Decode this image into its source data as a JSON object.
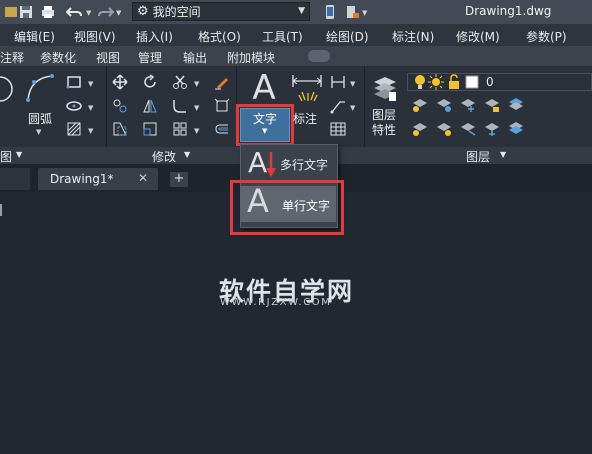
{
  "window": {
    "workspace": "我的空间",
    "document_title": "Drawing1.dwg"
  },
  "menu": {
    "items": [
      "编辑(E)",
      "视图(V)",
      "插入(I)",
      "格式(O)",
      "工具(T)",
      "绘图(D)",
      "标注(N)",
      "修改(M)",
      "参数(P)"
    ]
  },
  "ribbon_tabs": {
    "items": [
      "注释",
      "参数化",
      "视图",
      "管理",
      "输出",
      "附加模块"
    ]
  },
  "draw_panel": {
    "arc_label": "圆弧",
    "footer_label": "图"
  },
  "modify_panel": {
    "footer_label": "修改"
  },
  "annotation_panel": {
    "text_button_label": "文字",
    "dimension_label": "标注"
  },
  "layers_panel": {
    "layer_props_label_line1": "图层",
    "layer_props_label_line2": "特性",
    "current_layer": "0",
    "footer_label": "图层"
  },
  "text_dropdown": {
    "multiline_label": "多行文字",
    "single_line_label": "单行文字"
  },
  "doc_tabs": {
    "active_tab": "Drawing1*",
    "close_glyph": "✕",
    "new_tab_glyph": "+"
  },
  "watermark": {
    "main": "软件自学网",
    "sub": "WWW.RJZXW.COM"
  },
  "colors": {
    "accent_blue": "#3f6f9c",
    "highlight_red": "#e23b3b",
    "canvas_bg": "#212832",
    "bulb_yellow": "#f2c230"
  }
}
